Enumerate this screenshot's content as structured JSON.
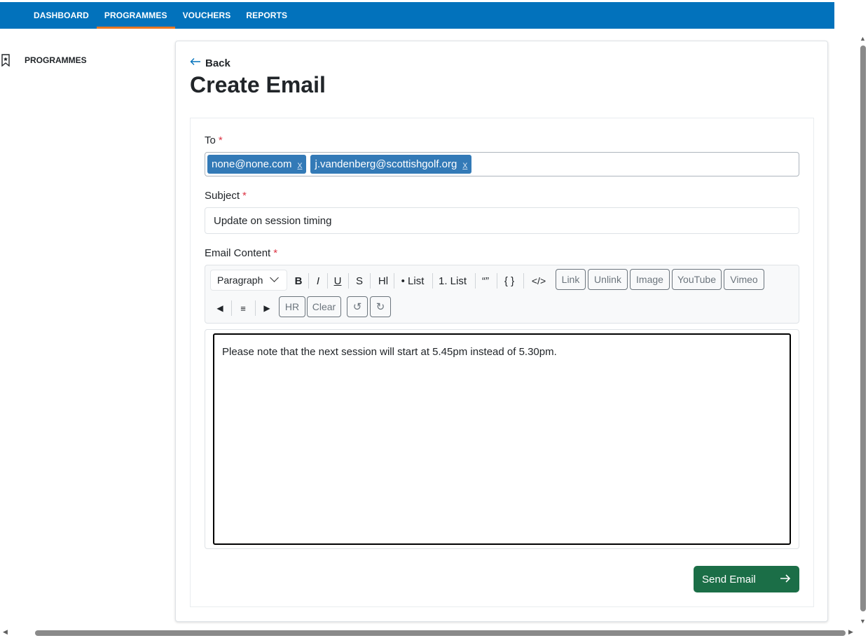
{
  "nav": {
    "items": [
      "DASHBOARD",
      "PROGRAMMES",
      "VOUCHERS",
      "REPORTS"
    ],
    "active": "PROGRAMMES"
  },
  "sidebar": {
    "items": [
      {
        "label": "PROGRAMMES",
        "icon": "bookmark-icon"
      }
    ]
  },
  "header": {
    "back_label": "Back",
    "title": "Create Email"
  },
  "form": {
    "to_label": "To",
    "required_mark": "*",
    "recipients": [
      "none@none.com",
      "j.vandenberg@scottishgolf.org"
    ],
    "remove_mark": "x",
    "subject_label": "Subject",
    "subject_value": "Update on session timing",
    "content_label": "Email Content",
    "content_value": "Please note that the next session will start at 5.45pm instead of 5.30pm.",
    "send_label": "Send Email"
  },
  "toolbar": {
    "block_select": "Paragraph",
    "bold": "B",
    "italic": "I",
    "underline": "U",
    "strike": "S",
    "heading": "Hl",
    "bullet_list": "• List",
    "ordered_list": "1. List",
    "quote": "“”",
    "code_block": "{ }",
    "code": "</>",
    "link": "Link",
    "unlink": "Unlink",
    "image": "Image",
    "youtube": "YouTube",
    "vimeo": "Vimeo",
    "align_left": "◀",
    "align_center": "≡",
    "align_right": "▶",
    "hr": "HR",
    "clear": "Clear",
    "undo": "↺",
    "redo": "↻"
  },
  "colors": {
    "nav_bg": "#0272bc",
    "active_underline": "#e87722",
    "chip_bg": "#337ab7",
    "send_bg": "#1b6e47",
    "required": "#dc3545"
  }
}
